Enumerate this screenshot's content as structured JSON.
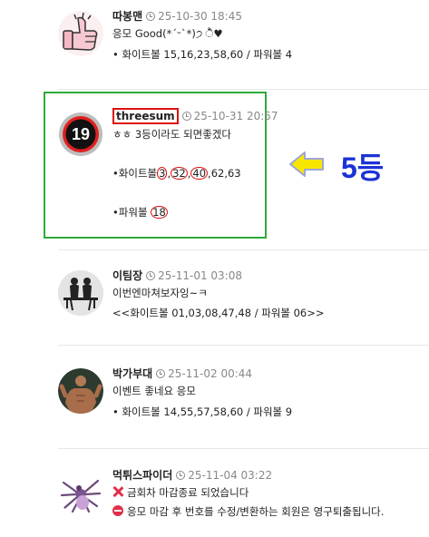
{
  "comments": [
    {
      "author": "따봉맨",
      "time": "25-10-30 18:45",
      "body": "응모 Good(*ˊᵕˋ*)੭ ੈ♥",
      "numbers": "• 화이트볼 15,16,23,58,60 / 파워볼 4"
    },
    {
      "author": "threesum",
      "time": "25-10-31 20:57",
      "body": "ㅎㅎ 3등이라도 되면좋겠다",
      "white_prefix": "•화이트볼",
      "white_hits": [
        "3",
        "32",
        "40"
      ],
      "white_rest": "62,63",
      "power_prefix": "•파워볼",
      "power_hit": "18",
      "badge": "19"
    },
    {
      "author": "이팀장",
      "time": "25-11-01 03:08",
      "body": "이번엔마쳐보자잉~ㅋ",
      "numbers": "<<화이트볼 01,03,08,47,48 / 파워볼 06>>"
    },
    {
      "author": "박가부대",
      "time": "25-11-02 00:44",
      "body": "이벤트 좋네요 응모",
      "numbers": "• 화이트볼 14,55,57,58,60 / 파워볼 9"
    },
    {
      "author": "먹튀스파이더",
      "time": "25-11-04 03:22",
      "notice1": "금회차 마감종료 되었습니다",
      "notice2": "응모 마감 후 번호를 수정/변환하는 회원은 영구퇴출됩니다."
    }
  ],
  "annotation": {
    "rank": "5등"
  },
  "colors": {
    "highlight": "#2faa3a",
    "mark": "#dd1111",
    "rank": "#1b33d6",
    "arrow": "#f7e600"
  }
}
